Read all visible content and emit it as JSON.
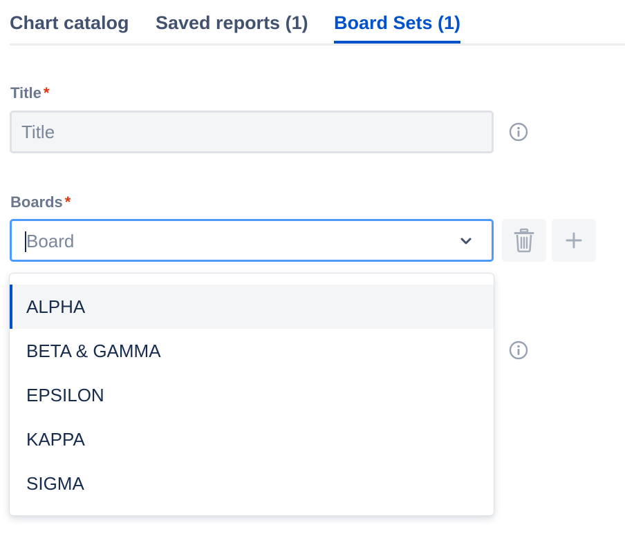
{
  "tabs": [
    {
      "label": "Chart catalog"
    },
    {
      "label": "Saved reports (1)"
    },
    {
      "label": "Board Sets (1)"
    }
  ],
  "active_tab": "Board Sets (1)",
  "form": {
    "title": {
      "label": "Title",
      "required_mark": "*",
      "placeholder": "Title",
      "value": ""
    },
    "boards": {
      "label": "Boards",
      "required_mark": "*",
      "placeholder": "Board",
      "options": [
        {
          "label": "ALPHA"
        },
        {
          "label": "BETA & GAMMA"
        },
        {
          "label": "EPSILON"
        },
        {
          "label": "KAPPA"
        },
        {
          "label": "SIGMA"
        }
      ],
      "highlighted_option": "ALPHA"
    }
  },
  "icons": {
    "info": "info-circle-icon",
    "chevron": "chevron-down-icon",
    "delete": "trash-icon",
    "add": "plus-icon"
  },
  "colors": {
    "accent": "#0052cc",
    "focus_border": "#4c9aff",
    "required": "#de350b",
    "label": "#6b778c",
    "tab_text": "#42526e",
    "text": "#172b4d",
    "field_bg": "#f4f5f7"
  }
}
